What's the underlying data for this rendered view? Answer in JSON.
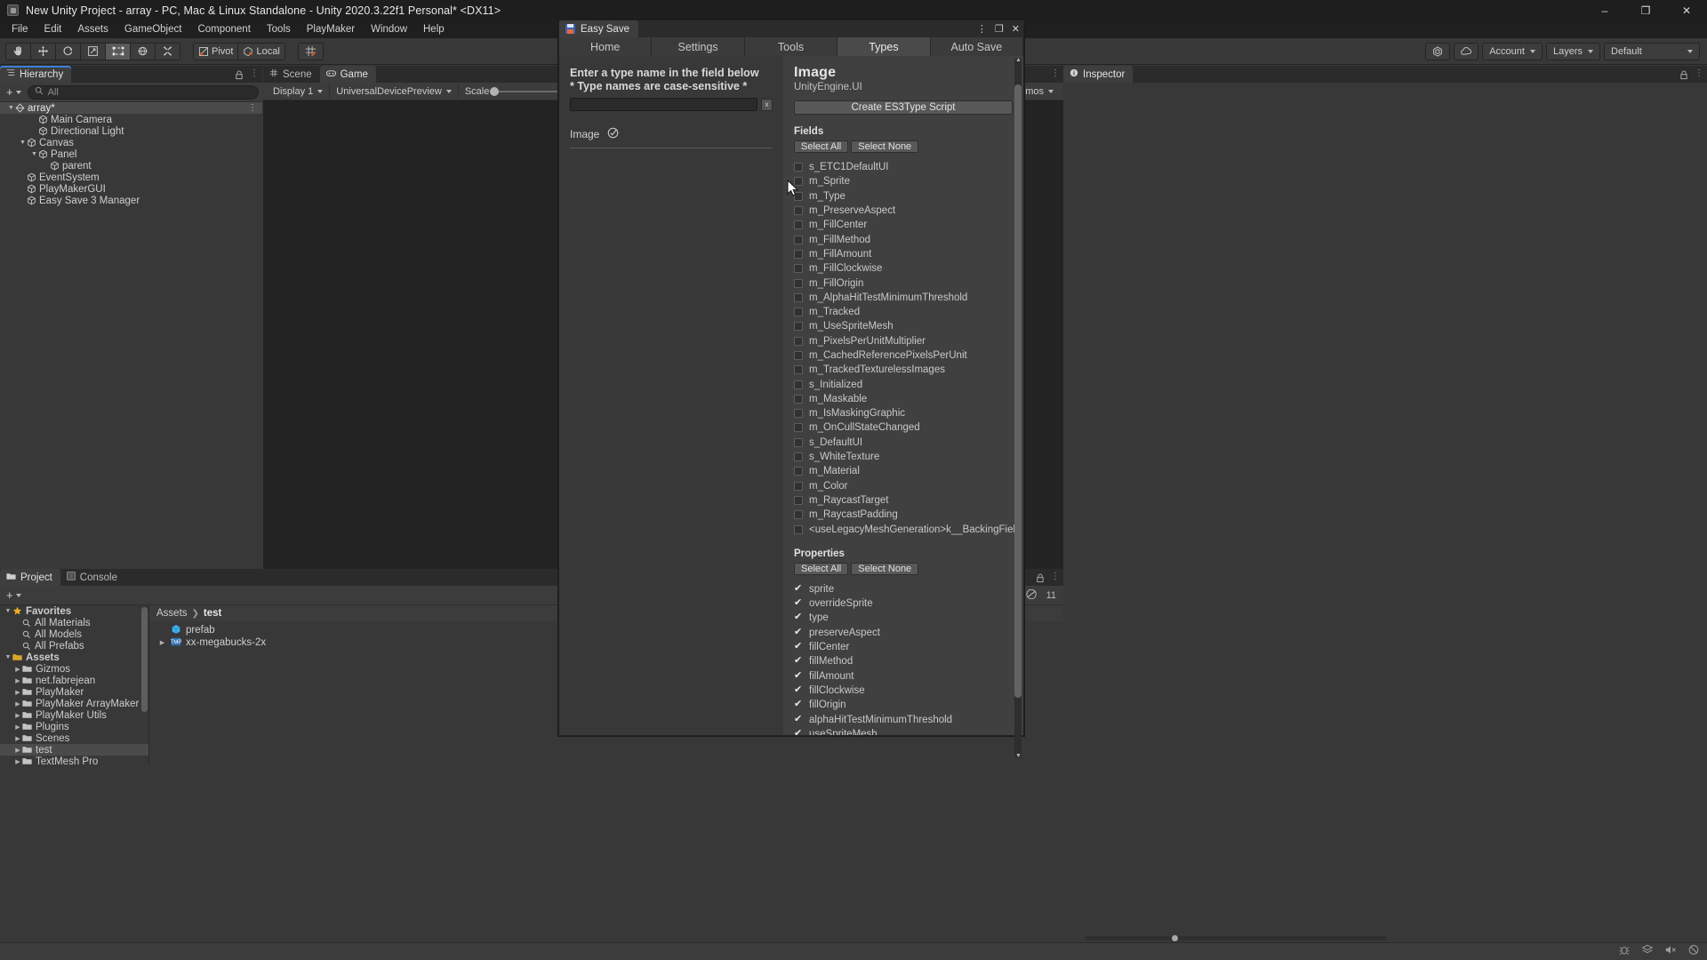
{
  "window": {
    "title": "New Unity Project - array - PC, Mac & Linux Standalone - Unity 2020.3.22f1 Personal* <DX11>",
    "minimize": "–",
    "maximize": "❐",
    "close": "✕"
  },
  "menubar": {
    "items": [
      "File",
      "Edit",
      "Assets",
      "GameObject",
      "Component",
      "Tools",
      "PlayMaker",
      "Window",
      "Help"
    ]
  },
  "toolbar": {
    "tools": [
      "hand-tool",
      "move-tool",
      "rotate-tool",
      "scale-tool",
      "rect-tool",
      "transform-tool",
      "custom-tool"
    ],
    "pivot_label": "Pivot",
    "space_label": "Local",
    "grid_label": "grid-snap",
    "account_label": "Account",
    "layers_label": "Layers",
    "layout_label": "Default"
  },
  "hierarchy": {
    "tab_label": "Hierarchy",
    "add_label": "+",
    "search_placeholder": "All",
    "items": [
      {
        "label": "array*",
        "depth": 0,
        "expanded": true,
        "type": "scene"
      },
      {
        "label": "Main Camera",
        "depth": 2,
        "expanded": null,
        "type": "gameobject"
      },
      {
        "label": "Directional Light",
        "depth": 2,
        "expanded": null,
        "type": "gameobject"
      },
      {
        "label": "Canvas",
        "depth": 1,
        "expanded": true,
        "type": "gameobject"
      },
      {
        "label": "Panel",
        "depth": 2,
        "expanded": true,
        "type": "gameobject"
      },
      {
        "label": "parent",
        "depth": 3,
        "expanded": null,
        "type": "gameobject"
      },
      {
        "label": "EventSystem",
        "depth": 1,
        "expanded": null,
        "type": "gameobject"
      },
      {
        "label": "PlayMakerGUI",
        "depth": 1,
        "expanded": null,
        "type": "gameobject"
      },
      {
        "label": "Easy Save 3 Manager",
        "depth": 1,
        "expanded": null,
        "type": "gameobject"
      }
    ]
  },
  "sceneview": {
    "tabs": [
      {
        "label": "Scene",
        "active": false
      },
      {
        "label": "Game",
        "active": true
      }
    ],
    "display_label": "Display 1",
    "device_label": "UniversalDevicePreview",
    "scale_label": "Scale",
    "gizmos_label": "zmos"
  },
  "inspector": {
    "tab_label": "Inspector"
  },
  "project": {
    "tabs": [
      {
        "label": "Project",
        "active": true
      },
      {
        "label": "Console",
        "active": false
      }
    ],
    "add_label": "+",
    "favorites": {
      "label": "Favorites",
      "items": [
        "All Materials",
        "All Models",
        "All Prefabs"
      ]
    },
    "assets": {
      "label": "Assets",
      "items": [
        {
          "label": "Gizmos",
          "selected": false
        },
        {
          "label": "net.fabrejean",
          "selected": false
        },
        {
          "label": "PlayMaker",
          "selected": false
        },
        {
          "label": "PlayMaker ArrayMaker",
          "selected": false
        },
        {
          "label": "PlayMaker Utils",
          "selected": false
        },
        {
          "label": "Plugins",
          "selected": false
        },
        {
          "label": "Scenes",
          "selected": false
        },
        {
          "label": "test",
          "selected": true
        },
        {
          "label": "TextMesh Pro",
          "selected": false
        }
      ]
    },
    "breadcrumb": [
      "Assets",
      "test"
    ],
    "files": [
      {
        "label": "prefab",
        "icon": "prefab-icon",
        "expandable": false
      },
      {
        "label": "xx-megabucks-2x",
        "icon": "font-icon",
        "expandable": true
      }
    ],
    "item_count": "11"
  },
  "easy_save": {
    "window_title": "Easy Save",
    "window_buttons": {
      "menu": "⋮",
      "maximize": "❐",
      "close": "✕"
    },
    "tabs": [
      {
        "label": "Home",
        "active": false
      },
      {
        "label": "Settings",
        "active": false
      },
      {
        "label": "Tools",
        "active": false
      },
      {
        "label": "Types",
        "active": true
      },
      {
        "label": "Auto Save",
        "active": false
      }
    ],
    "search": {
      "heading_line1": "Enter a type name in the field below",
      "heading_line2": "* Type names are case-sensitive *",
      "value": "",
      "placeholder": "",
      "clear_label": "x"
    },
    "result": {
      "label": "Image",
      "status_icon": "circled-check-icon"
    },
    "detail": {
      "type_name": "Image",
      "namespace": "UnityEngine.UI",
      "create_button": "Create ES3Type Script",
      "fields_title": "Fields",
      "properties_title": "Properties",
      "select_all_label": "Select All",
      "select_none_label": "Select None",
      "fields": [
        {
          "label": "s_ETC1DefaultUI",
          "checked": false
        },
        {
          "label": "m_Sprite",
          "checked": false
        },
        {
          "label": "m_Type",
          "checked": false
        },
        {
          "label": "m_PreserveAspect",
          "checked": false
        },
        {
          "label": "m_FillCenter",
          "checked": false
        },
        {
          "label": "m_FillMethod",
          "checked": false
        },
        {
          "label": "m_FillAmount",
          "checked": false
        },
        {
          "label": "m_FillClockwise",
          "checked": false
        },
        {
          "label": "m_FillOrigin",
          "checked": false
        },
        {
          "label": "m_AlphaHitTestMinimumThreshold",
          "checked": false
        },
        {
          "label": "m_Tracked",
          "checked": false
        },
        {
          "label": "m_UseSpriteMesh",
          "checked": false
        },
        {
          "label": "m_PixelsPerUnitMultiplier",
          "checked": false
        },
        {
          "label": "m_CachedReferencePixelsPerUnit",
          "checked": false
        },
        {
          "label": "m_TrackedTexturelessImages",
          "checked": false
        },
        {
          "label": "s_Initialized",
          "checked": false
        },
        {
          "label": "m_Maskable",
          "checked": false
        },
        {
          "label": "m_IsMaskingGraphic",
          "checked": false
        },
        {
          "label": "m_OnCullStateChanged",
          "checked": false
        },
        {
          "label": "s_DefaultUI",
          "checked": false
        },
        {
          "label": "s_WhiteTexture",
          "checked": false
        },
        {
          "label": "m_Material",
          "checked": false
        },
        {
          "label": "m_Color",
          "checked": false
        },
        {
          "label": "m_RaycastTarget",
          "checked": false
        },
        {
          "label": "m_RaycastPadding",
          "checked": false
        },
        {
          "label": "<useLegacyMeshGeneration>k__BackingField",
          "checked": false
        }
      ],
      "properties": [
        {
          "label": "sprite",
          "checked": true
        },
        {
          "label": "overrideSprite",
          "checked": true
        },
        {
          "label": "type",
          "checked": true
        },
        {
          "label": "preserveAspect",
          "checked": true
        },
        {
          "label": "fillCenter",
          "checked": true
        },
        {
          "label": "fillMethod",
          "checked": true
        },
        {
          "label": "fillAmount",
          "checked": true
        },
        {
          "label": "fillClockwise",
          "checked": true
        },
        {
          "label": "fillOrigin",
          "checked": true
        },
        {
          "label": "alphaHitTestMinimumThreshold",
          "checked": true
        },
        {
          "label": "useSpriteMesh",
          "checked": true
        }
      ]
    }
  }
}
